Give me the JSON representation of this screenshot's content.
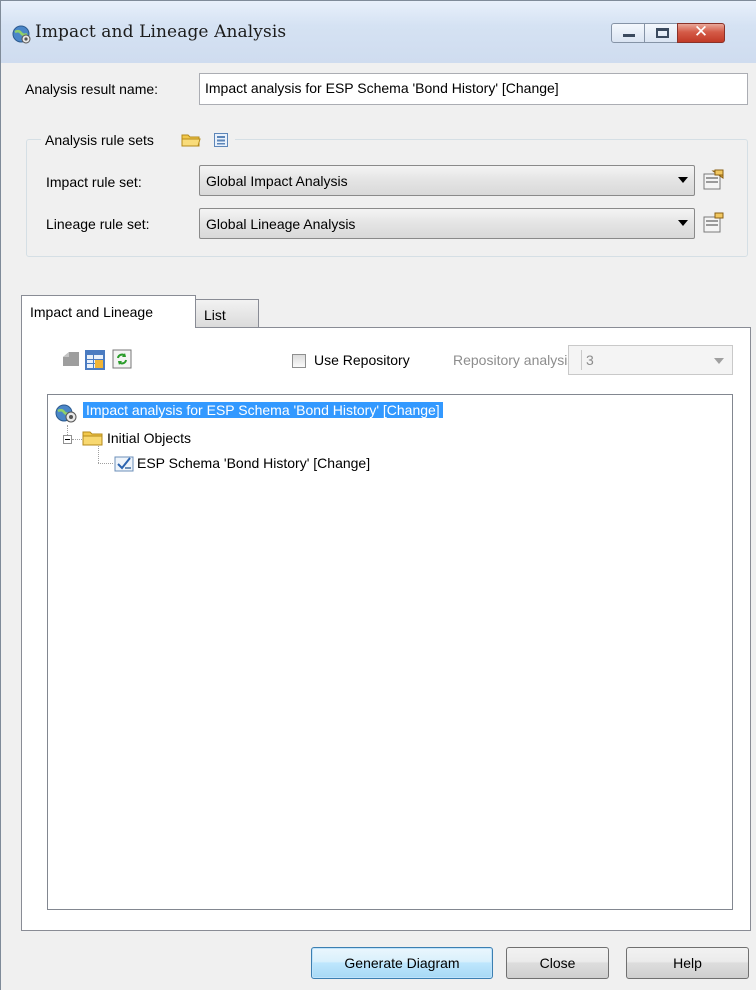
{
  "window": {
    "title": "Impact and Lineage Analysis",
    "close_glyph": "✕"
  },
  "result_name": {
    "label": "Analysis result name:",
    "value": "Impact analysis for ESP Schema 'Bond History' [Change]"
  },
  "rule_sets": {
    "group_label": "Analysis rule sets",
    "impact_label": "Impact rule set:",
    "impact_value": "Global Impact Analysis",
    "lineage_label": "Lineage rule set:",
    "lineage_value": "Global Lineage Analysis"
  },
  "tabs": [
    {
      "label": "Impact and Lineage",
      "active": true
    },
    {
      "label": "List",
      "active": false
    }
  ],
  "toolbar": {
    "use_repository_label": "Use Repository",
    "use_repository_checked": false,
    "repo_level_label": "Repository analysis level:",
    "repo_level_value": "3"
  },
  "tree": {
    "root": "Impact analysis for ESP Schema 'Bond History' [Change]",
    "folder": "Initial Objects",
    "item": "ESP Schema 'Bond History' [Change]"
  },
  "buttons": {
    "generate": "Generate Diagram",
    "close": "Close",
    "help": "Help"
  }
}
